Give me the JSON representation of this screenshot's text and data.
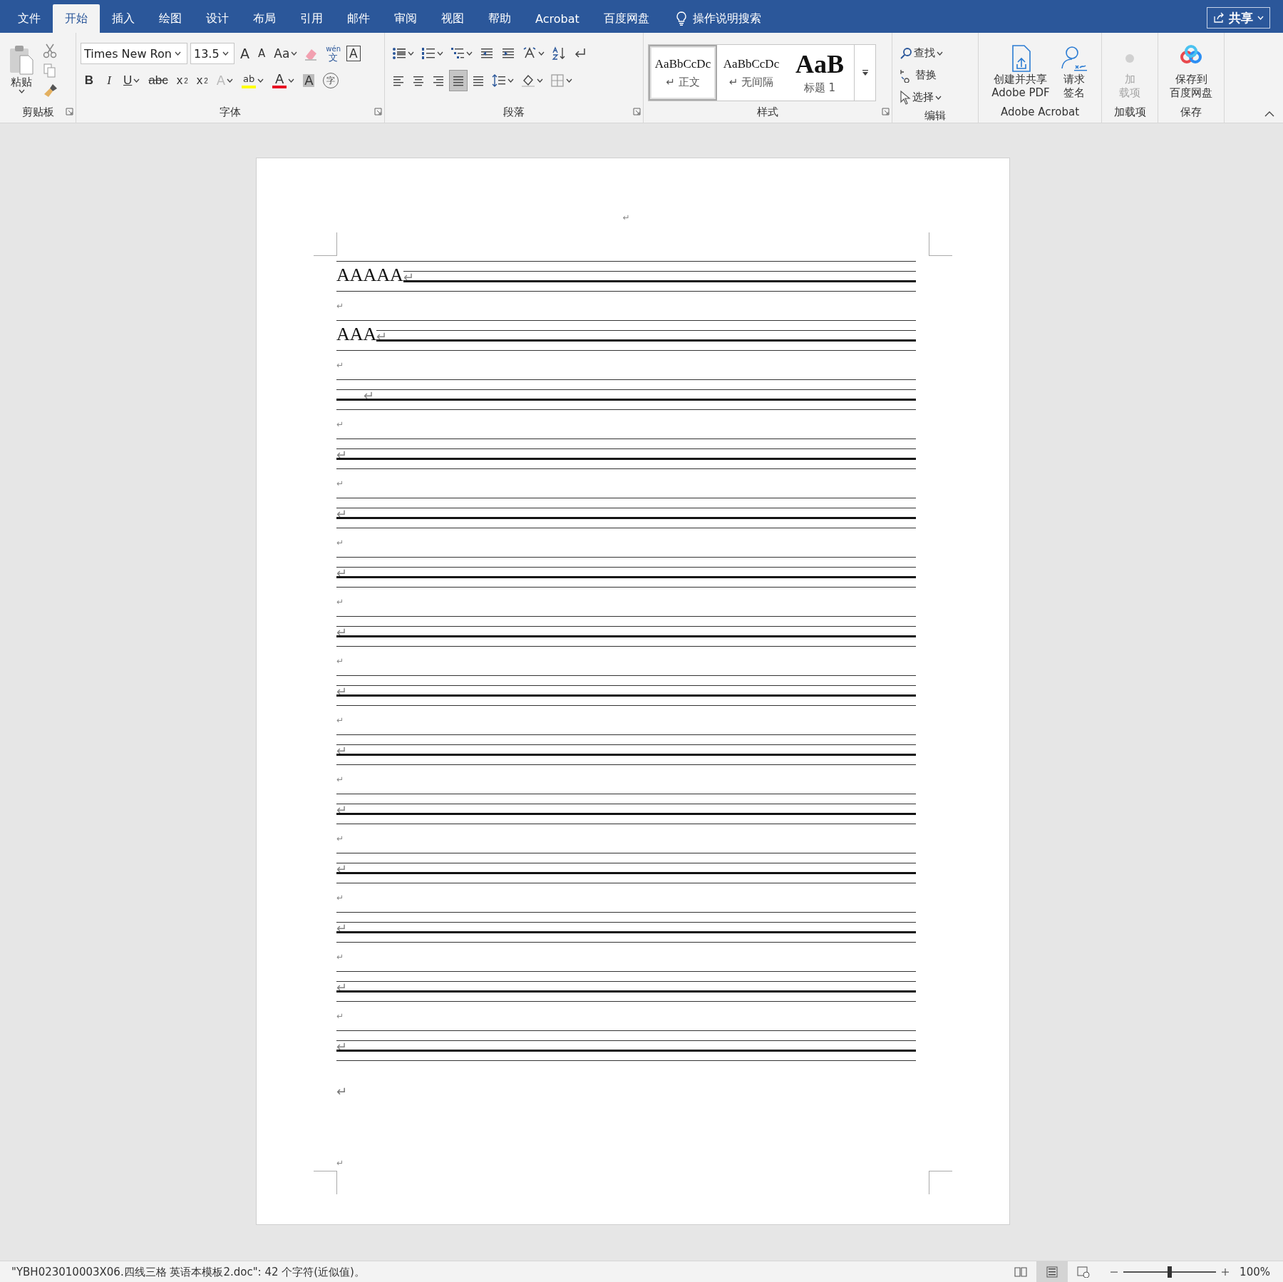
{
  "tabs": [
    {
      "label": "文件",
      "selected": false
    },
    {
      "label": "开始",
      "selected": true
    },
    {
      "label": "插入",
      "selected": false
    },
    {
      "label": "绘图",
      "selected": false
    },
    {
      "label": "设计",
      "selected": false
    },
    {
      "label": "布局",
      "selected": false
    },
    {
      "label": "引用",
      "selected": false
    },
    {
      "label": "邮件",
      "selected": false
    },
    {
      "label": "审阅",
      "selected": false
    },
    {
      "label": "视图",
      "selected": false
    },
    {
      "label": "帮助",
      "selected": false
    },
    {
      "label": "Acrobat",
      "selected": false
    },
    {
      "label": "百度网盘",
      "selected": false
    }
  ],
  "tell_me": "操作说明搜索",
  "share": "共享",
  "clipboard": {
    "label": "剪贴板",
    "paste": "粘贴"
  },
  "font": {
    "label": "字体",
    "font_name": "Times New Ron",
    "font_size": "13.5",
    "change_case": "Aa",
    "grow": "A",
    "shrink": "A",
    "phonetic_top": "wén",
    "phonetic": "文",
    "border_char": "A",
    "format_buttons": [
      {
        "kind": "bold",
        "glyph": "B"
      },
      {
        "kind": "italic",
        "glyph": "I"
      },
      {
        "kind": "underline",
        "glyph": "U"
      },
      {
        "kind": "strike",
        "glyph": "abc"
      },
      {
        "kind": "sub",
        "glyph": "x",
        "script": "2"
      },
      {
        "kind": "sup",
        "glyph": "x",
        "script": "2"
      }
    ],
    "effects": [
      {
        "kind": "effects",
        "glyph": "A",
        "disabled": true
      },
      {
        "kind": "highlight",
        "glyph": "ab",
        "color": "#ffff00",
        "disabled": false
      },
      {
        "kind": "fontcolor",
        "glyph": "A",
        "color": "#e81123",
        "disabled": false
      },
      {
        "kind": "shading",
        "glyph": "A",
        "disabled": false
      },
      {
        "kind": "enclose",
        "glyph": "字",
        "disabled": false
      }
    ]
  },
  "paragraph": {
    "label": "段落",
    "alignment": [
      {
        "kind": "left",
        "selected": false
      },
      {
        "kind": "center",
        "selected": false
      },
      {
        "kind": "right",
        "selected": false
      },
      {
        "kind": "justify",
        "selected": true
      },
      {
        "kind": "distributed",
        "selected": false
      }
    ]
  },
  "styles": {
    "label": "样式",
    "items": [
      {
        "preview": "AaBbCcDc",
        "name": "↵ 正文",
        "kind": "normal",
        "selected": true
      },
      {
        "preview": "AaBbCcDc",
        "name": "↵ 无间隔",
        "kind": "normal",
        "selected": false
      },
      {
        "preview": "AaB",
        "name": "标题 1",
        "kind": "heading",
        "selected": false
      }
    ]
  },
  "editing": {
    "label": "编辑",
    "items": [
      {
        "kind": "find",
        "label": "查找"
      },
      {
        "kind": "replace",
        "label": "替换"
      },
      {
        "kind": "select",
        "label": "选择"
      }
    ]
  },
  "acrobat": {
    "label": "Adobe Acrobat",
    "buttons": [
      {
        "kind": "pdf",
        "lines": [
          "创建并共享",
          "Adobe PDF"
        ]
      },
      {
        "kind": "sign",
        "lines": [
          "请求",
          "签名"
        ]
      }
    ]
  },
  "addins": {
    "label": "加载项",
    "button": {
      "lines": [
        "加",
        "载项"
      ],
      "disabled": true
    }
  },
  "save": {
    "label": "保存",
    "button": {
      "lines": [
        "保存到",
        "百度网盘"
      ]
    }
  },
  "document": {
    "header_mark": "↵",
    "staves": [
      {
        "text": "AAAAA",
        "mark": "↵",
        "indent": false,
        "after": "↵"
      },
      {
        "text": "AAA",
        "mark": "↵",
        "indent": false,
        "after": "↵"
      },
      {
        "mark": "↵",
        "indent": true,
        "after": "↵"
      },
      {
        "mark": "↵",
        "indent": false,
        "after": "↵"
      },
      {
        "mark": "↵",
        "indent": false,
        "after": "↵"
      },
      {
        "mark": "↵",
        "indent": false,
        "after": "↵"
      },
      {
        "mark": "↵",
        "indent": false,
        "after": "↵"
      },
      {
        "mark": "↵",
        "indent": false,
        "after": "↵"
      },
      {
        "mark": "↵",
        "indent": false,
        "after": "↵"
      },
      {
        "mark": "↵",
        "indent": false,
        "after": "↵"
      },
      {
        "mark": "↵",
        "indent": false,
        "after": "↵"
      },
      {
        "mark": "↵",
        "indent": false,
        "after": "↵"
      },
      {
        "mark": "↵",
        "indent": false,
        "after": "↵"
      },
      {
        "mark": "↵",
        "indent": false
      }
    ],
    "end_marks": [
      "↵",
      "↵"
    ]
  },
  "status_bar": {
    "text": "\"YBH023010003X06.四线三格 英语本模板2.doc\": 42 个字符(近似值)。",
    "views": [
      {
        "kind": "read",
        "selected": false
      },
      {
        "kind": "print",
        "selected": true
      },
      {
        "kind": "web",
        "selected": false
      }
    ],
    "zoom": {
      "level": 0.5,
      "reading": "100%"
    }
  }
}
